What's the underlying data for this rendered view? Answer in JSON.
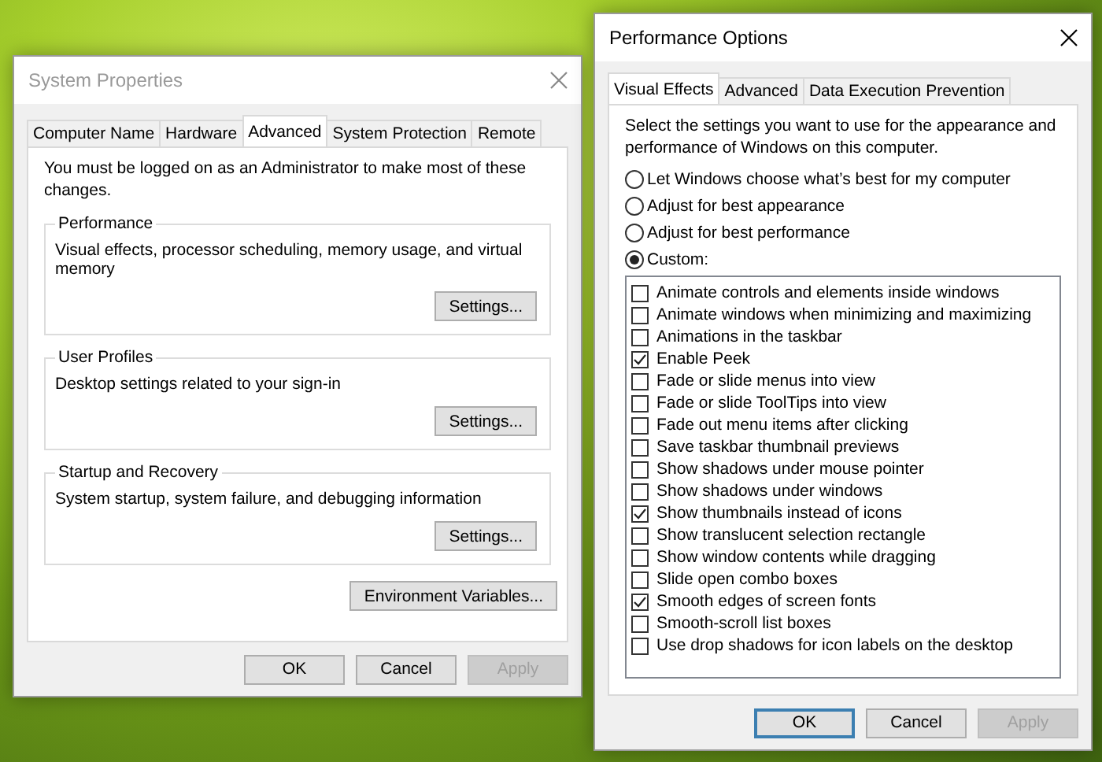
{
  "desktop": {
    "windows": [
      {
        "title": "System Properties",
        "active": false,
        "tabs": [
          {
            "label": "Computer Name",
            "selected": false
          },
          {
            "label": "Hardware",
            "selected": false
          },
          {
            "label": "Advanced",
            "selected": true
          },
          {
            "label": "System Protection",
            "selected": false
          },
          {
            "label": "Remote",
            "selected": false
          }
        ],
        "content": [
          {
            "kind": "text",
            "text": "You must be logged on as an Administrator to make most of these changes."
          },
          {
            "kind": "group",
            "label": "Performance",
            "text": "Visual effects, processor scheduling, memory usage, and virtual memory",
            "button": "Settings..."
          },
          {
            "kind": "group",
            "label": "User Profiles",
            "text": "Desktop settings related to your sign-in",
            "button": "Settings..."
          },
          {
            "kind": "group",
            "label": "Startup and Recovery",
            "text": "System startup, system failure, and debugging information",
            "button": "Settings..."
          },
          {
            "kind": "button",
            "label": "Environment Variables..."
          }
        ],
        "buttons": [
          {
            "label": "OK",
            "default": false,
            "disabled": false
          },
          {
            "label": "Cancel",
            "default": false,
            "disabled": false
          },
          {
            "label": "Apply",
            "default": false,
            "disabled": true
          }
        ]
      },
      {
        "title": "Performance Options",
        "active": true,
        "tabs": [
          {
            "label": "Visual Effects",
            "selected": true
          },
          {
            "label": "Advanced",
            "selected": false
          },
          {
            "label": "Data Execution Prevention",
            "selected": false
          }
        ],
        "content": [
          {
            "kind": "text",
            "text": "Select the settings you want to use for the appearance and performance of Windows on this computer."
          },
          {
            "kind": "radio",
            "label": "Let Windows choose what’s best for my computer",
            "selected": false
          },
          {
            "kind": "radio",
            "label": "Adjust for best appearance",
            "selected": false
          },
          {
            "kind": "radio",
            "label": "Adjust for best performance",
            "selected": false
          },
          {
            "kind": "radio",
            "label": "Custom:",
            "selected": true
          },
          {
            "kind": "checklist",
            "items": [
              {
                "label": "Animate controls and elements inside windows",
                "checked": false
              },
              {
                "label": "Animate windows when minimizing and maximizing",
                "checked": false
              },
              {
                "label": "Animations in the taskbar",
                "checked": false
              },
              {
                "label": "Enable Peek",
                "checked": true
              },
              {
                "label": "Fade or slide menus into view",
                "checked": false
              },
              {
                "label": "Fade or slide ToolTips into view",
                "checked": false
              },
              {
                "label": "Fade out menu items after clicking",
                "checked": false
              },
              {
                "label": "Save taskbar thumbnail previews",
                "checked": false
              },
              {
                "label": "Show shadows under mouse pointer",
                "checked": false
              },
              {
                "label": "Show shadows under windows",
                "checked": false
              },
              {
                "label": "Show thumbnails instead of icons",
                "checked": true
              },
              {
                "label": "Show translucent selection rectangle",
                "checked": false
              },
              {
                "label": "Show window contents while dragging",
                "checked": false
              },
              {
                "label": "Slide open combo boxes",
                "checked": false
              },
              {
                "label": "Smooth edges of screen fonts",
                "checked": true
              },
              {
                "label": "Smooth-scroll list boxes",
                "checked": false
              },
              {
                "label": "Use drop shadows for icon labels on the desktop",
                "checked": false
              }
            ]
          }
        ],
        "buttons": [
          {
            "label": "OK",
            "default": true,
            "disabled": false
          },
          {
            "label": "Cancel",
            "default": false,
            "disabled": false
          },
          {
            "label": "Apply",
            "default": false,
            "disabled": true
          }
        ]
      }
    ]
  }
}
